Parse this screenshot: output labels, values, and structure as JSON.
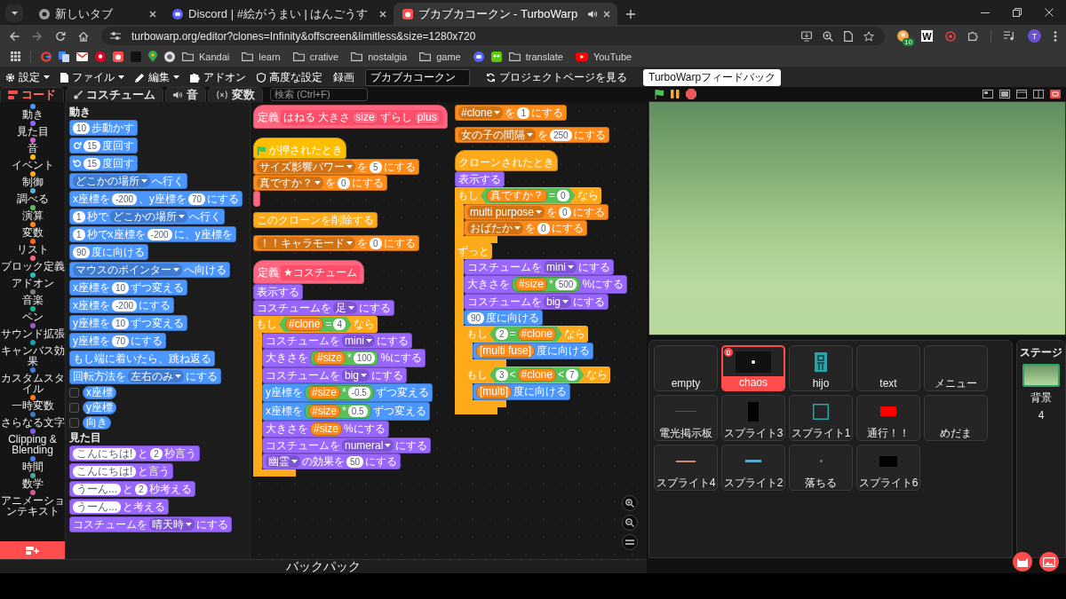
{
  "browser": {
    "tabs": [
      {
        "title": "新しいタブ",
        "selected": false,
        "audio": false
      },
      {
        "title": "Discord | #絵がうまい | はんごうす",
        "selected": false,
        "audio": false
      },
      {
        "title": "ブカブカコークン - TurboWarp",
        "selected": true,
        "audio": true
      }
    ],
    "url": "turbowarp.org/editor?clones=Infinity&offscreen&limitless&size=1280x720",
    "extension_badge": "10",
    "extension_letter": "W",
    "profile_initial": "T",
    "bookmarks": [
      {
        "kind": "app"
      },
      {
        "kind": "app"
      },
      {
        "kind": "app"
      },
      {
        "kind": "app"
      },
      {
        "kind": "app"
      },
      {
        "kind": "app"
      },
      {
        "kind": "app"
      },
      {
        "kind": "app"
      },
      {
        "kind": "folder",
        "label": "Kandai"
      },
      {
        "kind": "folder",
        "label": "learn"
      },
      {
        "kind": "folder",
        "label": "crative"
      },
      {
        "kind": "folder",
        "label": "nostalgia"
      },
      {
        "kind": "folder",
        "label": "game"
      },
      {
        "kind": "app"
      },
      {
        "kind": "app"
      },
      {
        "kind": "folder",
        "label": "translate"
      },
      {
        "kind": "site",
        "label": "YouTube"
      }
    ]
  },
  "menu_bar": {
    "items": [
      {
        "label": "設定",
        "dropdown": true
      },
      {
        "label": "ファイル",
        "dropdown": true
      },
      {
        "label": "編集",
        "dropdown": true
      },
      {
        "label": "アドオン",
        "dropdown": false
      },
      {
        "label": "高度な設定",
        "dropdown": false
      },
      {
        "label": "録画",
        "dropdown": false
      }
    ],
    "project_title": "ブカブカコークン",
    "project_page": "プロジェクトページを見る",
    "feedback": "TurboWarpフィードバック"
  },
  "editor": {
    "tabs": [
      {
        "label": "コード",
        "selected": true
      },
      {
        "label": "コスチューム",
        "selected": false
      },
      {
        "label": "音",
        "selected": false
      },
      {
        "label": "変数",
        "selected": false
      }
    ],
    "search": {
      "placeholder": "検索 (Ctrl+F)"
    },
    "categories": [
      {
        "label": "動き",
        "color": "#4c97ff"
      },
      {
        "label": "見た目",
        "color": "#9966ff"
      },
      {
        "label": "音",
        "color": "#cf63cf"
      },
      {
        "label": "イベント",
        "color": "#ffbf00"
      },
      {
        "label": "制御",
        "color": "#ffab19"
      },
      {
        "label": "調べる",
        "color": "#5cb1d6"
      },
      {
        "label": "演算",
        "color": "#59c059"
      },
      {
        "label": "変数",
        "color": "#ff8c1a"
      },
      {
        "label": "リスト",
        "color": "#ff661a"
      },
      {
        "label": "ブロック定義",
        "color": "#ff6680"
      },
      {
        "label": "アドオン",
        "color": "#29beb8"
      },
      {
        "label": "音楽",
        "color": "#7c7c7c"
      },
      {
        "label": "ペン",
        "color": "#0fbd8c"
      },
      {
        "label": "サウンド拡張",
        "color": "#a35ac9"
      },
      {
        "label": "キャンバス効果",
        "color": "#1b9fb8"
      },
      {
        "label": "カスタムスタイル",
        "color": "#3d7de0"
      },
      {
        "label": "一時変数",
        "color": "#ff7a1a"
      },
      {
        "label": "さらなる文字",
        "color": "#3f7fbf"
      },
      {
        "label": "Clipping & Blending",
        "color": "#8a5cf0"
      },
      {
        "label": "時間",
        "color": "#4a7ff2"
      },
      {
        "label": "数学",
        "color": "#46a89a"
      },
      {
        "label": "アニメーションテキスト",
        "color": "#d35a9a"
      }
    ],
    "palette": [
      {
        "title": "動き",
        "blocks": [
          {
            "kind": "stack",
            "color": "#4c97ff",
            "parts": [
              {
                "kind": "num",
                "text": "10"
              },
              {
                "kind": "text",
                "text": "歩動かす"
              }
            ]
          },
          {
            "kind": "stack",
            "color": "#4c97ff",
            "parts": [
              {
                "kind": "turn",
                "clockwise": true
              },
              {
                "kind": "num",
                "text": "15"
              },
              {
                "kind": "text",
                "text": "度回す"
              }
            ]
          },
          {
            "kind": "stack",
            "color": "#4c97ff",
            "parts": [
              {
                "kind": "turn",
                "clockwise": false
              },
              {
                "kind": "num",
                "text": "15"
              },
              {
                "kind": "text",
                "text": "度回す"
              }
            ]
          },
          {
            "kind": "stack",
            "color": "#4c97ff",
            "parts": [
              {
                "kind": "menu",
                "text": "どこかの場所"
              },
              {
                "kind": "text",
                "text": "へ行く"
              }
            ]
          },
          {
            "kind": "stack",
            "color": "#4c97ff",
            "parts": [
              {
                "kind": "text",
                "text": "x座標を"
              },
              {
                "kind": "num",
                "text": "-200"
              },
              {
                "kind": "text",
                "text": "、y座標を"
              },
              {
                "kind": "num",
                "text": "70"
              },
              {
                "kind": "text",
                "text": "にする"
              }
            ]
          },
          {
            "kind": "stack",
            "color": "#4c97ff",
            "parts": [
              {
                "kind": "num",
                "text": "1"
              },
              {
                "kind": "text",
                "text": "秒で"
              },
              {
                "kind": "menu",
                "text": "どこかの場所"
              },
              {
                "kind": "text",
                "text": "へ行く"
              }
            ]
          },
          {
            "kind": "stack",
            "color": "#4c97ff",
            "parts": [
              {
                "kind": "num",
                "text": "1"
              },
              {
                "kind": "text",
                "text": "秒でx座標を"
              },
              {
                "kind": "num",
                "text": "-200"
              },
              {
                "kind": "text",
                "text": "に、y座標を"
              }
            ]
          },
          {
            "kind": "stack",
            "color": "#4c97ff",
            "parts": [
              {
                "kind": "num",
                "text": "90"
              },
              {
                "kind": "text",
                "text": "度に向ける"
              }
            ]
          },
          {
            "kind": "stack",
            "color": "#4c97ff",
            "parts": [
              {
                "kind": "menu",
                "text": "マウスのポインター"
              },
              {
                "kind": "text",
                "text": "へ向ける"
              }
            ]
          },
          {
            "kind": "stack",
            "color": "#4c97ff",
            "parts": [
              {
                "kind": "text",
                "text": "x座標を"
              },
              {
                "kind": "num",
                "text": "10"
              },
              {
                "kind": "text",
                "text": "ずつ変える"
              }
            ]
          },
          {
            "kind": "stack",
            "color": "#4c97ff",
            "parts": [
              {
                "kind": "text",
                "text": "x座標を"
              },
              {
                "kind": "num",
                "text": "-200"
              },
              {
                "kind": "text",
                "text": "にする"
              }
            ]
          },
          {
            "kind": "stack",
            "color": "#4c97ff",
            "parts": [
              {
                "kind": "text",
                "text": "y座標を"
              },
              {
                "kind": "num",
                "text": "10"
              },
              {
                "kind": "text",
                "text": "ずつ変える"
              }
            ]
          },
          {
            "kind": "stack",
            "color": "#4c97ff",
            "parts": [
              {
                "kind": "text",
                "text": "y座標を"
              },
              {
                "kind": "num",
                "text": "70"
              },
              {
                "kind": "text",
                "text": "にする"
              }
            ]
          },
          {
            "kind": "stack",
            "color": "#4c97ff",
            "parts": [
              {
                "kind": "text",
                "text": "もし端に着いたら、跳ね返る"
              }
            ]
          },
          {
            "kind": "stack",
            "color": "#4c97ff",
            "parts": [
              {
                "kind": "text",
                "text": "回転方法を"
              },
              {
                "kind": "menu",
                "text": "左右のみ"
              },
              {
                "kind": "text",
                "text": "にする"
              }
            ]
          },
          {
            "kind": "monitor",
            "color": "#4c97ff",
            "checked": false,
            "parts": [
              {
                "kind": "text",
                "text": "x座標"
              }
            ]
          },
          {
            "kind": "monitor",
            "color": "#4c97ff",
            "checked": false,
            "parts": [
              {
                "kind": "text",
                "text": "y座標"
              }
            ]
          },
          {
            "kind": "monitor",
            "color": "#4c97ff",
            "checked": false,
            "parts": [
              {
                "kind": "text",
                "text": "向き"
              }
            ]
          }
        ]
      },
      {
        "title": "見た目",
        "blocks": [
          {
            "kind": "stack",
            "color": "#9966ff",
            "parts": [
              {
                "kind": "str",
                "text": "こんにちは!"
              },
              {
                "kind": "text",
                "text": "と"
              },
              {
                "kind": "num",
                "text": "2"
              },
              {
                "kind": "text",
                "text": "秒言う"
              }
            ]
          },
          {
            "kind": "stack",
            "color": "#9966ff",
            "parts": [
              {
                "kind": "str",
                "text": "こんにちは!"
              },
              {
                "kind": "text",
                "text": "と言う"
              }
            ]
          },
          {
            "kind": "stack",
            "color": "#9966ff",
            "parts": [
              {
                "kind": "str",
                "text": "うーん..."
              },
              {
                "kind": "text",
                "text": "と"
              },
              {
                "kind": "num",
                "text": "2"
              },
              {
                "kind": "text",
                "text": "秒考える"
              }
            ]
          },
          {
            "kind": "stack",
            "color": "#9966ff",
            "parts": [
              {
                "kind": "str",
                "text": "うーん..."
              },
              {
                "kind": "text",
                "text": "と考える"
              }
            ]
          },
          {
            "kind": "stack",
            "color": "#9966ff",
            "parts": [
              {
                "kind": "text",
                "text": "コスチュームを"
              },
              {
                "kind": "menu",
                "text": "晴天時"
              },
              {
                "kind": "text",
                "text": "にする"
              }
            ]
          }
        ]
      }
    ],
    "scripts": [
      [
        {
          "kind": "define",
          "color": "#ff6680",
          "parts": [
            {
              "kind": "text",
              "text": "定義"
            },
            {
              "kind": "proto",
              "color": "#ff4d6a",
              "parts": [
                {
                  "kind": "text",
                  "text": "はねる 大きさ"
                },
                {
                  "kind": "rep",
                  "color": "#ff6680",
                  "parts": [
                    {
                      "kind": "text",
                      "text": "size"
                    }
                  ]
                },
                {
                  "kind": "text",
                  "text": "ずらし"
                },
                {
                  "kind": "rep",
                  "color": "#ff6680",
                  "parts": [
                    {
                      "kind": "text",
                      "text": "plus"
                    }
                  ]
                }
              ]
            }
          ]
        }
      ],
      [
        {
          "kind": "hat",
          "color": "#ffbf00",
          "parts": [
            {
              "kind": "flag"
            },
            {
              "kind": "text",
              "text": "が押されたとき"
            }
          ]
        },
        {
          "kind": "stack",
          "color": "#ff8c1a",
          "parts": [
            {
              "kind": "menu",
              "text": "サイズ影響パワー"
            },
            {
              "kind": "text",
              "text": "を"
            },
            {
              "kind": "num",
              "text": "5"
            },
            {
              "kind": "text",
              "text": "にする"
            }
          ]
        },
        {
          "kind": "stack",
          "color": "#ff8c1a",
          "parts": [
            {
              "kind": "menu",
              "text": "真ですか？"
            },
            {
              "kind": "text",
              "text": "を"
            },
            {
              "kind": "num",
              "text": "0"
            },
            {
              "kind": "text",
              "text": "にする"
            }
          ]
        },
        {
          "kind": "stack",
          "color": "#ff6680"
        }
      ],
      [
        {
          "kind": "stack",
          "color": "#ffab19",
          "parts": [
            {
              "kind": "text",
              "text": "このクローンを削除する"
            }
          ]
        }
      ],
      [
        {
          "kind": "stack",
          "color": "#ff8c1a",
          "parts": [
            {
              "kind": "menu",
              "text": "！！キャラモード"
            },
            {
              "kind": "text",
              "text": "を"
            },
            {
              "kind": "num",
              "text": "0"
            },
            {
              "kind": "text",
              "text": "にする"
            }
          ]
        }
      ],
      [
        {
          "kind": "define",
          "color": "#ff6680",
          "parts": [
            {
              "kind": "text",
              "text": "定義"
            },
            {
              "kind": "proto",
              "color": "#ff4d6a",
              "parts": [
                {
                  "kind": "text",
                  "text": "★コスチューム"
                }
              ]
            }
          ]
        },
        {
          "kind": "stack",
          "color": "#9966ff",
          "parts": [
            {
              "kind": "text",
              "text": "表示する"
            }
          ]
        },
        {
          "kind": "stack",
          "color": "#9966ff",
          "parts": [
            {
              "kind": "text",
              "text": "コスチュームを"
            },
            {
              "kind": "menu",
              "text": "足"
            },
            {
              "kind": "text",
              "text": "にする"
            }
          ]
        },
        {
          "kind": "c",
          "color": "#ffab19",
          "parts": [
            {
              "kind": "text",
              "text": "もし"
            },
            {
              "kind": "bool",
              "color": "#59c059",
              "parts": [
                {
                  "kind": "rep",
                  "color": "#ff8c1a",
                  "parts": [
                    {
                      "kind": "text",
                      "text": "#clone"
                    }
                  ]
                },
                {
                  "kind": "text",
                  "text": "="
                },
                {
                  "kind": "num",
                  "text": "4"
                }
              ]
            },
            {
              "kind": "text",
              "text": "なら"
            }
          ],
          "children": [
            {
              "kind": "stack",
              "color": "#9966ff",
              "parts": [
                {
                  "kind": "text",
                  "text": "コスチュームを"
                },
                {
                  "kind": "menu",
                  "text": "mini"
                },
                {
                  "kind": "text",
                  "text": "にする"
                }
              ]
            },
            {
              "kind": "stack",
              "color": "#9966ff",
              "parts": [
                {
                  "kind": "text",
                  "text": "大きさを"
                },
                {
                  "kind": "rep",
                  "color": "#59c059",
                  "parts": [
                    {
                      "kind": "rep",
                      "color": "#ff8c1a",
                      "parts": [
                        {
                          "kind": "text",
                          "text": "#size"
                        }
                      ]
                    },
                    {
                      "kind": "text",
                      "text": "*"
                    },
                    {
                      "kind": "num",
                      "text": "100"
                    }
                  ]
                },
                {
                  "kind": "text",
                  "text": "%にする"
                }
              ]
            },
            {
              "kind": "stack",
              "color": "#9966ff",
              "parts": [
                {
                  "kind": "text",
                  "text": "コスチュームを"
                },
                {
                  "kind": "menu",
                  "text": "big"
                },
                {
                  "kind": "text",
                  "text": "にする"
                }
              ]
            },
            {
              "kind": "stack",
              "color": "#4c97ff",
              "parts": [
                {
                  "kind": "text",
                  "text": "y座標を"
                },
                {
                  "kind": "rep",
                  "color": "#59c059",
                  "parts": [
                    {
                      "kind": "rep",
                      "color": "#ff8c1a",
                      "parts": [
                        {
                          "kind": "text",
                          "text": "#size"
                        }
                      ]
                    },
                    {
                      "kind": "text",
                      "text": "*"
                    },
                    {
                      "kind": "num",
                      "text": "-0.5"
                    }
                  ]
                },
                {
                  "kind": "text",
                  "text": "ずつ変える"
                }
              ]
            },
            {
              "kind": "stack",
              "color": "#4c97ff",
              "parts": [
                {
                  "kind": "text",
                  "text": "x座標を"
                },
                {
                  "kind": "rep",
                  "color": "#59c059",
                  "parts": [
                    {
                      "kind": "rep",
                      "color": "#ff8c1a",
                      "parts": [
                        {
                          "kind": "text",
                          "text": "#size"
                        }
                      ]
                    },
                    {
                      "kind": "text",
                      "text": "*"
                    },
                    {
                      "kind": "num",
                      "text": "0.5"
                    }
                  ]
                },
                {
                  "kind": "text",
                  "text": "ずつ変える"
                }
              ]
            },
            {
              "kind": "stack",
              "color": "#9966ff",
              "parts": [
                {
                  "kind": "text",
                  "text": "大きさを"
                },
                {
                  "kind": "rep",
                  "color": "#ff8c1a",
                  "parts": [
                    {
                      "kind": "text",
                      "text": "#size"
                    }
                  ]
                },
                {
                  "kind": "text",
                  "text": "%にする"
                }
              ]
            },
            {
              "kind": "stack",
              "color": "#9966ff",
              "parts": [
                {
                  "kind": "text",
                  "text": "コスチュームを"
                },
                {
                  "kind": "menu",
                  "text": "numeral"
                },
                {
                  "kind": "text",
                  "text": "にする"
                }
              ]
            },
            {
              "kind": "stack",
              "color": "#9966ff",
              "parts": [
                {
                  "kind": "menu",
                  "text": "幽霊"
                },
                {
                  "kind": "text",
                  "text": "の効果を"
                },
                {
                  "kind": "num",
                  "text": "50"
                },
                {
                  "kind": "text",
                  "text": "にする"
                }
              ]
            }
          ]
        }
      ],
      [
        {
          "kind": "stack",
          "color": "#ff8c1a",
          "parts": [
            {
              "kind": "menu",
              "text": "#clone"
            },
            {
              "kind": "text",
              "text": "を"
            },
            {
              "kind": "num",
              "text": "1"
            },
            {
              "kind": "text",
              "text": "にする"
            }
          ]
        }
      ],
      [
        {
          "kind": "stack",
          "color": "#ff8c1a",
          "parts": [
            {
              "kind": "menu",
              "text": "女の子の間隔"
            },
            {
              "kind": "text",
              "text": "を"
            },
            {
              "kind": "num",
              "text": "250"
            },
            {
              "kind": "text",
              "text": "にする"
            }
          ]
        }
      ],
      [
        {
          "kind": "hat",
          "color": "#ffab19",
          "parts": [
            {
              "kind": "text",
              "text": "クローンされたとき"
            }
          ]
        },
        {
          "kind": "stack",
          "color": "#9966ff",
          "parts": [
            {
              "kind": "text",
              "text": "表示する"
            }
          ]
        },
        {
          "kind": "c",
          "color": "#ffab19",
          "parts": [
            {
              "kind": "text",
              "text": "もし"
            },
            {
              "kind": "bool",
              "color": "#59c059",
              "parts": [
                {
                  "kind": "rep",
                  "color": "#ff8c1a",
                  "parts": [
                    {
                      "kind": "text",
                      "text": "真ですか？"
                    }
                  ]
                },
                {
                  "kind": "text",
                  "text": "="
                },
                {
                  "kind": "num",
                  "text": "0"
                }
              ]
            },
            {
              "kind": "text",
              "text": "なら"
            }
          ],
          "children": [
            {
              "kind": "stack",
              "color": "#ff8c1a",
              "parts": [
                {
                  "kind": "menu",
                  "text": "multi purpose"
                },
                {
                  "kind": "text",
                  "text": "を"
                },
                {
                  "kind": "num",
                  "text": "0"
                },
                {
                  "kind": "text",
                  "text": "にする"
                }
              ]
            },
            {
              "kind": "stack",
              "color": "#ff8c1a",
              "parts": [
                {
                  "kind": "menu",
                  "text": "おばたか"
                },
                {
                  "kind": "text",
                  "text": "を"
                },
                {
                  "kind": "num",
                  "text": "0"
                },
                {
                  "kind": "text",
                  "text": "にする"
                }
              ]
            }
          ]
        },
        {
          "kind": "c",
          "color": "#ffab19",
          "parts": [
            {
              "kind": "text",
              "text": "ずっと"
            }
          ],
          "children": [
            {
              "kind": "stack",
              "color": "#9966ff",
              "parts": [
                {
                  "kind": "text",
                  "text": "コスチュームを"
                },
                {
                  "kind": "menu",
                  "text": "mini"
                },
                {
                  "kind": "text",
                  "text": "にする"
                }
              ]
            },
            {
              "kind": "stack",
              "color": "#9966ff",
              "parts": [
                {
                  "kind": "text",
                  "text": "大きさを"
                },
                {
                  "kind": "rep",
                  "color": "#59c059",
                  "parts": [
                    {
                      "kind": "rep",
                      "color": "#ff8c1a",
                      "parts": [
                        {
                          "kind": "text",
                          "text": "#size"
                        }
                      ]
                    },
                    {
                      "kind": "text",
                      "text": "*"
                    },
                    {
                      "kind": "num",
                      "text": "500"
                    }
                  ]
                },
                {
                  "kind": "text",
                  "text": "%にする"
                }
              ]
            },
            {
              "kind": "stack",
              "color": "#9966ff",
              "parts": [
                {
                  "kind": "text",
                  "text": "コスチュームを"
                },
                {
                  "kind": "menu",
                  "text": "big"
                },
                {
                  "kind": "text",
                  "text": "にする"
                }
              ]
            },
            {
              "kind": "stack",
              "color": "#4c97ff",
              "parts": [
                {
                  "kind": "num",
                  "text": "90"
                },
                {
                  "kind": "text",
                  "text": "度に向ける"
                }
              ]
            },
            {
              "kind": "c",
              "color": "#ffab19",
              "parts": [
                {
                  "kind": "text",
                  "text": "もし"
                },
                {
                  "kind": "bool",
                  "color": "#59c059",
                  "parts": [
                    {
                      "kind": "num",
                      "text": "2"
                    },
                    {
                      "kind": "text",
                      "text": "="
                    },
                    {
                      "kind": "rep",
                      "color": "#ff8c1a",
                      "parts": [
                        {
                          "kind": "text",
                          "text": "#clone"
                        }
                      ]
                    }
                  ]
                },
                {
                  "kind": "text",
                  "text": "なら"
                }
              ],
              "children": [
                {
                  "kind": "stack",
                  "color": "#4c97ff",
                  "parts": [
                    {
                      "kind": "rep",
                      "color": "#ff8c1a",
                      "parts": [
                        {
                          "kind": "text",
                          "text": "[multi fuse]"
                        }
                      ]
                    },
                    {
                      "kind": "text",
                      "text": "度に向ける"
                    }
                  ]
                }
              ]
            },
            {
              "kind": "c",
              "color": "#ffab19",
              "parts": [
                {
                  "kind": "text",
                  "text": "もし"
                },
                {
                  "kind": "bool",
                  "color": "#59c059",
                  "parts": [
                    {
                      "kind": "num",
                      "text": "3"
                    },
                    {
                      "kind": "text",
                      "text": "<"
                    },
                    {
                      "kind": "rep",
                      "color": "#ff8c1a",
                      "parts": [
                        {
                          "kind": "text",
                          "text": "#clone"
                        }
                      ]
                    },
                    {
                      "kind": "text",
                      "text": "<"
                    },
                    {
                      "kind": "num",
                      "text": "7"
                    }
                  ]
                },
                {
                  "kind": "text",
                  "text": "なら"
                }
              ],
              "children": [
                {
                  "kind": "stack",
                  "color": "#4c97ff",
                  "parts": [
                    {
                      "kind": "rep",
                      "color": "#ff8c1a",
                      "parts": [
                        {
                          "kind": "text",
                          "text": "[multi]"
                        }
                      ]
                    },
                    {
                      "kind": "text",
                      "text": "度に向ける"
                    }
                  ]
                }
              ]
            }
          ]
        }
      ]
    ],
    "backpack": "バックパック"
  },
  "stage": {
    "sprites": [
      {
        "name": "empty",
        "selected": false
      },
      {
        "name": "chaos",
        "selected": true
      },
      {
        "name": "hijo",
        "selected": false
      },
      {
        "name": "text",
        "selected": false
      },
      {
        "name": "メニュー",
        "selected": false
      },
      {
        "name": "電光掲示板",
        "selected": false
      },
      {
        "name": "スプライト3",
        "selected": false
      },
      {
        "name": "スプライト1",
        "selected": false
      },
      {
        "name": "通行！！",
        "selected": false
      },
      {
        "name": "めだま",
        "selected": false
      },
      {
        "name": "スプライト4",
        "selected": false
      },
      {
        "name": "スプライト2",
        "selected": false
      },
      {
        "name": "落ちる",
        "selected": false
      },
      {
        "name": "スプライト6",
        "selected": false
      }
    ],
    "target": {
      "title": "ステージ",
      "label": "背景",
      "count": "4"
    }
  }
}
